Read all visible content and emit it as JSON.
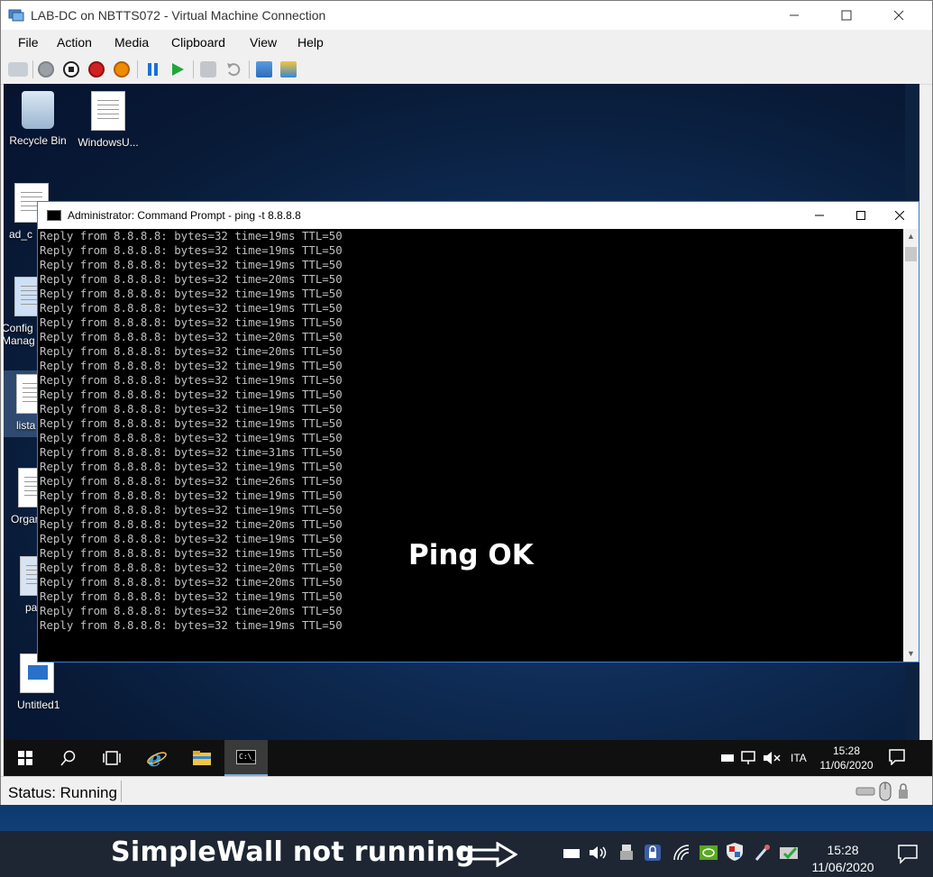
{
  "vm": {
    "title": "LAB-DC on NBTTS072 - Virtual Machine Connection",
    "menu": [
      "File",
      "Action",
      "Media",
      "Clipboard",
      "View",
      "Help"
    ],
    "status": "Status: Running"
  },
  "desktop": {
    "icons": [
      {
        "label": "Recycle Bin"
      },
      {
        "label": "WindowsU..."
      },
      {
        "label": "ad_c"
      },
      {
        "label": "Config\nManag"
      },
      {
        "label": "lista"
      },
      {
        "label": "Organ"
      },
      {
        "label": "pa"
      },
      {
        "label": "Untitled1"
      }
    ]
  },
  "cmd": {
    "title": "Administrator: Command Prompt - ping  -t 8.8.8.8",
    "line_prefix": "Reply from 8.8.8.8: bytes=32 time=",
    "line_suffix": "ms TTL=50",
    "times": [
      19,
      19,
      19,
      20,
      19,
      19,
      19,
      20,
      20,
      19,
      19,
      19,
      19,
      19,
      19,
      31,
      19,
      26,
      19,
      19,
      20,
      19,
      19,
      20,
      20,
      19,
      20,
      19
    ],
    "overlay": "Ping OK"
  },
  "guest_tray": {
    "lang": "ITA",
    "time": "15:28",
    "date": "11/06/2020"
  },
  "host": {
    "annotation": "SimpleWall not running",
    "time": "15:28",
    "date": "11/06/2020"
  }
}
